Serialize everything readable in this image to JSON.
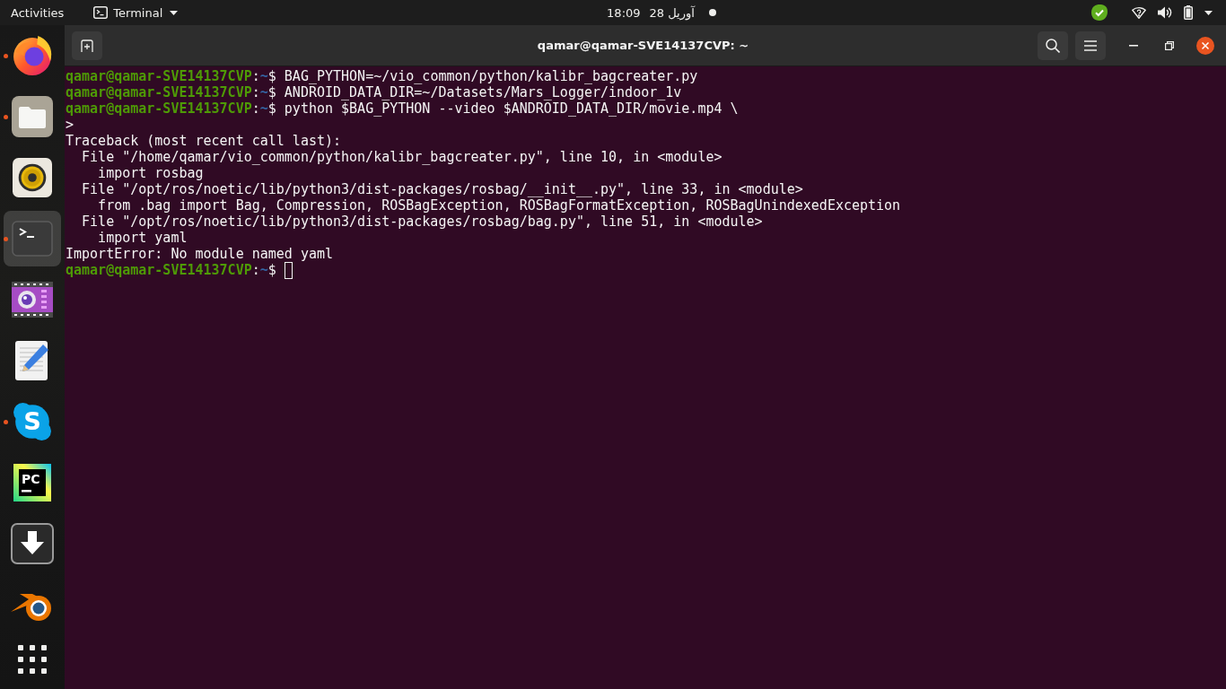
{
  "top_bar": {
    "activities": "Activities",
    "app_menu": "Terminal",
    "clock": {
      "time": "18:09",
      "date": "28 آوریل"
    }
  },
  "dock": {
    "items": [
      {
        "running": true,
        "focused": false
      },
      {
        "running": true,
        "focused": false
      },
      {
        "running": false,
        "focused": false
      },
      {
        "running": true,
        "focused": true
      },
      {
        "running": false,
        "focused": false
      },
      {
        "running": false,
        "focused": false
      },
      {
        "running": true,
        "focused": false,
        "glyph": "S"
      },
      {
        "running": false,
        "focused": false,
        "glyph": "PC"
      },
      {
        "running": false,
        "focused": false
      },
      {
        "running": false,
        "focused": false
      }
    ]
  },
  "window": {
    "title": "qamar@qamar-SVE14137CVP: ~"
  },
  "terminal": {
    "lines": [
      {
        "kind": "prompt",
        "user": "qamar@qamar-SVE14137CVP",
        "separator": ":",
        "path": "~",
        "symbol": "$",
        "command": "BAG_PYTHON=~/vio_common/python/kalibr_bagcreater.py",
        "cursor": false
      },
      {
        "kind": "prompt",
        "user": "qamar@qamar-SVE14137CVP",
        "separator": ":",
        "path": "~",
        "symbol": "$",
        "command": "ANDROID_DATA_DIR=~/Datasets/Mars_Logger/indoor_1v",
        "cursor": false
      },
      {
        "kind": "prompt",
        "user": "qamar@qamar-SVE14137CVP",
        "separator": ":",
        "path": "~",
        "symbol": "$",
        "command": "python $BAG_PYTHON --video $ANDROID_DATA_DIR/movie.mp4 \\",
        "cursor": false
      },
      {
        "kind": "output",
        "text": ">",
        "cursor": false
      },
      {
        "kind": "output",
        "text": "Traceback (most recent call last):",
        "cursor": false,
        "children": [
          {
            "text": "File \"/home/qamar/vio_common/python/kalibr_bagcreater.py\", line 10, in <module>",
            "children": [
              {
                "text": "import rosbag"
              }
            ]
          },
          {
            "text": "File \"/opt/ros/noetic/lib/python3/dist-packages/rosbag/__init__.py\", line 33, in <module>",
            "children": [
              {
                "text": "from .bag import Bag, Compression, ROSBagException, ROSBagFormatException, ROSBagUnindexedException"
              }
            ]
          },
          {
            "text": "File \"/opt/ros/noetic/lib/python3/dist-packages/rosbag/bag.py\", line 51, in <module>",
            "children": [
              {
                "text": "import yaml"
              }
            ]
          }
        ]
      },
      {
        "kind": "output",
        "text": "ImportError: No module named yaml",
        "cursor": false
      },
      {
        "kind": "prompt",
        "user": "qamar@qamar-SVE14137CVP",
        "separator": ":",
        "path": "~",
        "symbol": "$",
        "cursor": true
      }
    ]
  }
}
